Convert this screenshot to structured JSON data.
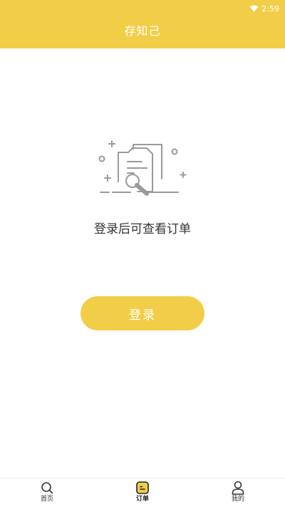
{
  "status_bar": {
    "time": "2:59",
    "wifi_icon": "wifi-icon"
  },
  "header": {
    "title": "存知己"
  },
  "empty_state": {
    "illustration_icon": "document-search-icon",
    "message": "登录后可查看订单"
  },
  "login_button": {
    "label": "登录"
  },
  "tabbar": {
    "items": [
      {
        "label": "首页",
        "icon": "search-icon",
        "active": false
      },
      {
        "label": "订单",
        "icon": "order-icon",
        "active": true
      },
      {
        "label": "我的",
        "icon": "user-icon",
        "active": false
      }
    ]
  },
  "colors": {
    "accent": "#f2ce48",
    "text": "#333333",
    "illustration": "#9a9a9a"
  }
}
